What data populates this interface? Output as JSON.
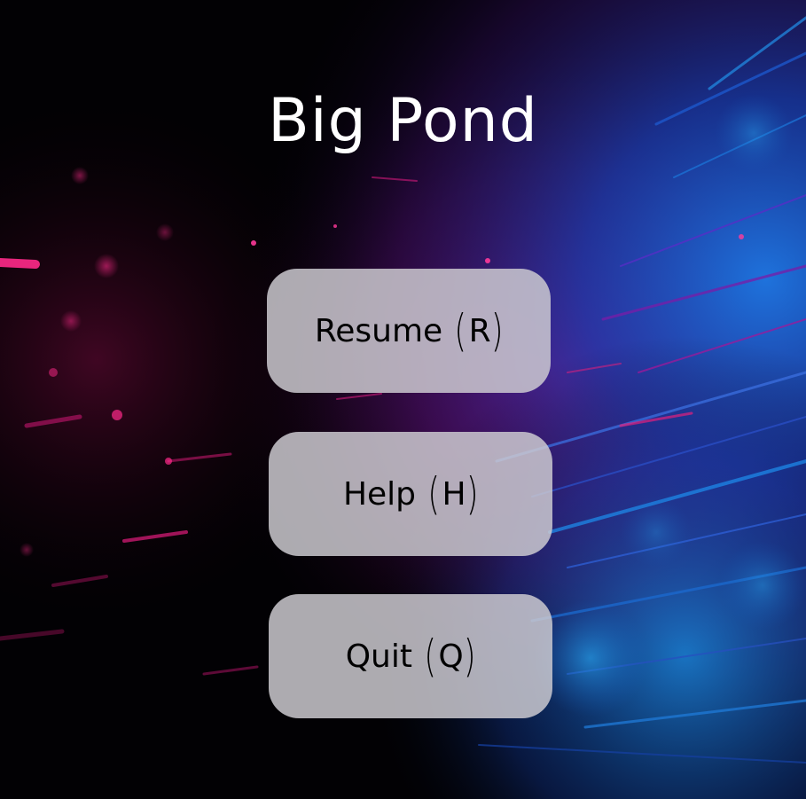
{
  "game": {
    "title": "Big Pond"
  },
  "menu": {
    "items": [
      {
        "label": "Resume",
        "key": "R"
      },
      {
        "label": "Help",
        "key": "H"
      },
      {
        "label": "Quit",
        "key": "Q"
      }
    ]
  },
  "theme": {
    "background": "#020104",
    "accent_magenta": "#c2186b",
    "accent_blue": "#1a6fd6",
    "button_fill": "#cecdd2",
    "title_color": "#ffffff"
  }
}
